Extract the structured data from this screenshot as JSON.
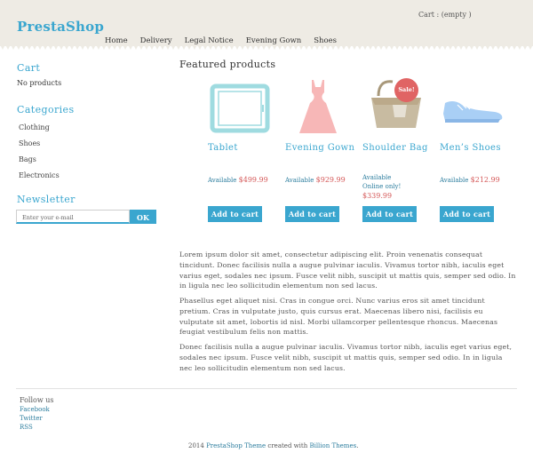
{
  "header": {
    "logo": "PrestaShop",
    "cart_status": "Cart : (empty )",
    "nav": [
      "Home",
      "Delivery",
      "Legal Notice",
      "Evening Gown",
      "Shoes"
    ]
  },
  "sidebar": {
    "cart_heading": "Cart",
    "cart_text": "No products",
    "categories_heading": "Categories",
    "categories": [
      "Clothing",
      "Shoes",
      "Bags",
      "Electronics"
    ],
    "newsletter_heading": "Newsletter",
    "newsletter_placeholder": "Enter your e-mail",
    "newsletter_button": "OK"
  },
  "featured": {
    "title": "Featured products",
    "products": [
      {
        "name": "Tablet",
        "availability": "Available",
        "online": "",
        "price": "$499.99",
        "button": "Add to cart",
        "icon": "tablet-icon",
        "color": "#9fdbe0"
      },
      {
        "name": "Evening Gown",
        "availability": "Available",
        "online": "",
        "price": "$929.99",
        "button": "Add to cart",
        "icon": "dress-icon",
        "color": "#f7b7b7"
      },
      {
        "name": "Shoulder Bag",
        "availability": "Available",
        "online": "Online only!",
        "price": "$339.99",
        "button": "Add to cart",
        "icon": "bag-icon",
        "badge": "Sale!",
        "color": "#c8bba1"
      },
      {
        "name": "Men’s Shoes",
        "availability": "Available",
        "online": "",
        "price": "$212.99",
        "button": "Add to cart",
        "icon": "shoe-icon",
        "color": "#a9cff5"
      }
    ]
  },
  "content": {
    "paragraphs": [
      "Lorem ipsum dolor sit amet, consectetur adipiscing elit. Proin venenatis consequat tincidunt. Donec facilisis nulla a augue pulvinar iaculis. Vivamus tortor nibh, iaculis eget varius eget, sodales nec ipsum. Fusce velit nibh, suscipit ut mattis quis, semper sed odio. In in ligula nec leo sollicitudin elementum non sed lacus.",
      "Phasellus eget aliquet nisi. Cras in congue orci. Nunc varius eros sit amet tincidunt pretium. Cras in vulputate justo, quis cursus erat. Maecenas libero nisi, facilisis eu vulputate sit amet, lobortis id nisl. Morbi ullamcorper pellentesque rhoncus. Maecenas feugiat vestibulum felis non mattis.",
      "Donec facilisis nulla a augue pulvinar iaculis. Vivamus tortor nibh, iaculis eget varius eget, sodales nec ipsum. Fusce velit nibh, suscipit ut mattis quis, semper sed odio. In in ligula nec leo sollicitudin elementum non sed lacus."
    ]
  },
  "footer": {
    "follow_heading": "Follow us",
    "links": [
      "Facebook",
      "Twitter",
      "RSS"
    ],
    "copy_prefix": "2014",
    "copy_theme": "PrestaShop Theme",
    "copy_mid": "created with",
    "copy_author": "Billion Themes",
    "copy_suffix": "."
  },
  "colors": {
    "accent": "#3aa6cf",
    "price": "#d55a5a",
    "header_bg": "#eeebe4"
  }
}
